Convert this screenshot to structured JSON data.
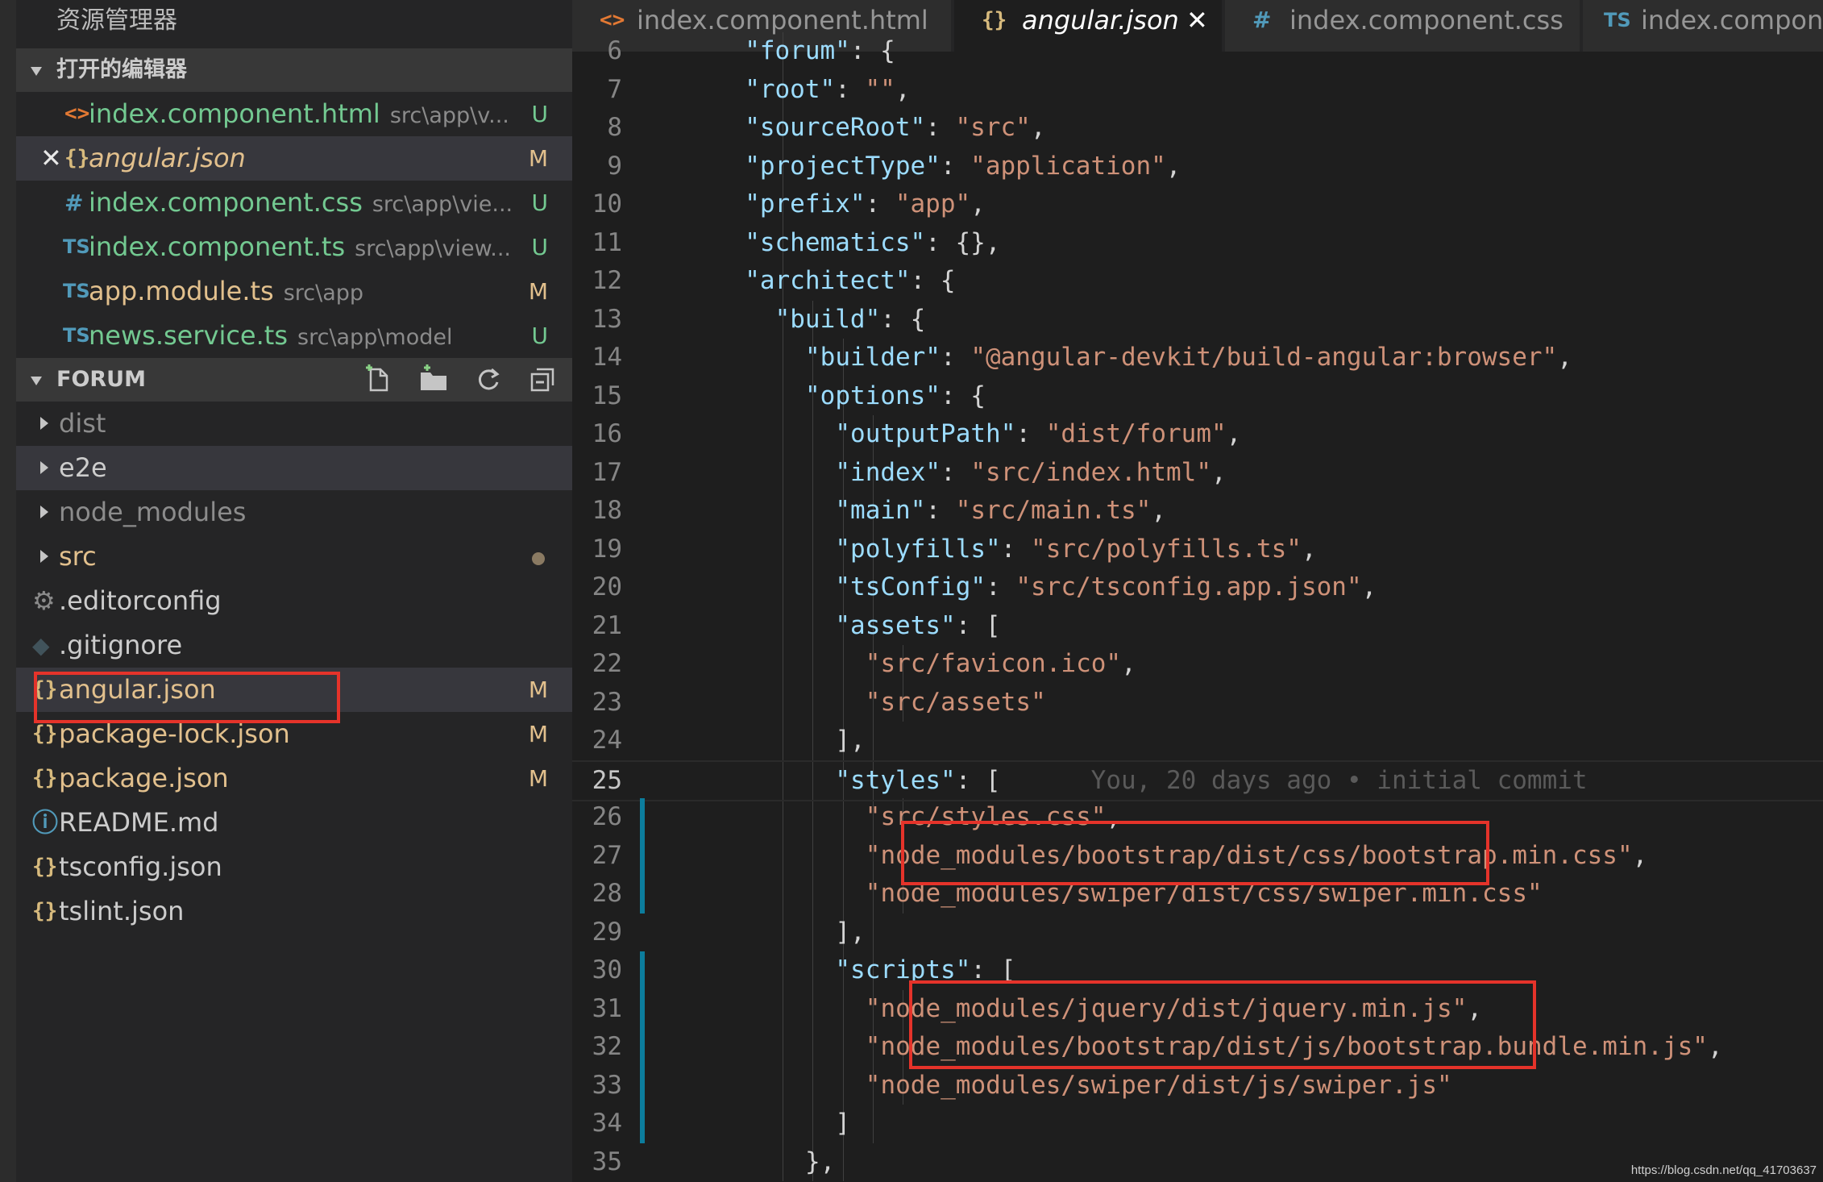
{
  "explorer": {
    "title": "资源管理器",
    "open_editors": {
      "header": "打开的编辑器",
      "items": [
        {
          "icon": "<>",
          "name": "index.component.html",
          "path": "src\\app\\v...",
          "badge": "U"
        },
        {
          "icon": "{}",
          "name": "angular.json",
          "path": "",
          "badge": "M"
        },
        {
          "icon": "#",
          "name": "index.component.css",
          "path": "src\\app\\vie...",
          "badge": "U"
        },
        {
          "icon": "TS",
          "name": "index.component.ts",
          "path": "src\\app\\view...",
          "badge": "U"
        },
        {
          "icon": "TS",
          "name": "app.module.ts",
          "path": "src\\app",
          "badge": "M"
        },
        {
          "icon": "TS",
          "name": "news.service.ts",
          "path": "src\\app\\model",
          "badge": "U"
        }
      ]
    },
    "project": {
      "header": "FORUM",
      "items": [
        {
          "name": "dist"
        },
        {
          "name": "e2e"
        },
        {
          "name": "node_modules"
        },
        {
          "name": "src"
        },
        {
          "name": ".editorconfig"
        },
        {
          "name": ".gitignore"
        },
        {
          "name": "angular.json",
          "badge": "M"
        },
        {
          "name": "package-lock.json",
          "badge": "M"
        },
        {
          "name": "package.json",
          "badge": "M"
        },
        {
          "name": "README.md"
        },
        {
          "name": "tsconfig.json"
        },
        {
          "name": "tslint.json"
        }
      ]
    }
  },
  "tabs": [
    {
      "icon": "<>",
      "label": "index.component.html"
    },
    {
      "icon": "{}",
      "label": "angular.json",
      "close": "✕"
    },
    {
      "icon": "#",
      "label": "index.component.css"
    },
    {
      "icon": "TS",
      "label": "index.compone"
    }
  ],
  "code": {
    "lines": [
      {
        "n": "6",
        "indent": 3,
        "key": "forum",
        "rest": ": {"
      },
      {
        "n": "7",
        "indent": 3,
        "key": "root",
        "str": "\"\"",
        "tail": ","
      },
      {
        "n": "8",
        "indent": 3,
        "key": "sourceRoot",
        "str": "\"src\"",
        "tail": ","
      },
      {
        "n": "9",
        "indent": 3,
        "key": "projectType",
        "str": "\"application\"",
        "tail": ","
      },
      {
        "n": "10",
        "indent": 3,
        "key": "prefix",
        "str": "\"app\"",
        "tail": ","
      },
      {
        "n": "11",
        "indent": 3,
        "key": "schematics",
        "rest": ": {},"
      },
      {
        "n": "12",
        "indent": 3,
        "key": "architect",
        "rest": ": {"
      },
      {
        "n": "13",
        "indent": 4,
        "key": "build",
        "rest": ": {"
      },
      {
        "n": "14",
        "indent": 5,
        "key": "builder",
        "str": "\"@angular-devkit/build-angular:browser\"",
        "tail": ","
      },
      {
        "n": "15",
        "indent": 5,
        "key": "options",
        "rest": ": {"
      },
      {
        "n": "16",
        "indent": 6,
        "key": "outputPath",
        "str": "\"dist/forum\"",
        "tail": ","
      },
      {
        "n": "17",
        "indent": 6,
        "key": "index",
        "str": "\"src/index.html\"",
        "tail": ","
      },
      {
        "n": "18",
        "indent": 6,
        "key": "main",
        "str": "\"src/main.ts\"",
        "tail": ","
      },
      {
        "n": "19",
        "indent": 6,
        "key": "polyfills",
        "str": "\"src/polyfills.ts\"",
        "tail": ","
      },
      {
        "n": "20",
        "indent": 6,
        "key": "tsConfig",
        "str": "\"src/tsconfig.app.json\"",
        "tail": ","
      },
      {
        "n": "21",
        "indent": 6,
        "key": "assets",
        "rest": ": ["
      },
      {
        "n": "22",
        "indent": 7,
        "str": "\"src/favicon.ico\"",
        "tail": ","
      },
      {
        "n": "23",
        "indent": 7,
        "str": "\"src/assets\"",
        "tail": ""
      },
      {
        "n": "24",
        "indent": 6,
        "rest": "],"
      },
      {
        "n": "25",
        "indent": 6,
        "key": "styles",
        "rest": ": [",
        "blame": "You, 20 days ago • initial commit"
      },
      {
        "n": "26",
        "indent": 7,
        "str": "\"src/styles.css\"",
        "tail": ","
      },
      {
        "n": "27",
        "indent": 7,
        "str": "\"node_modules/bootstrap/dist/css/bootstrap.min.css\"",
        "tail": ","
      },
      {
        "n": "28",
        "indent": 7,
        "str": "\"node_modules/swiper/dist/css/swiper.min.css\"",
        "tail": ""
      },
      {
        "n": "29",
        "indent": 6,
        "rest": "],"
      },
      {
        "n": "30",
        "indent": 6,
        "key": "scripts",
        "rest": ": ["
      },
      {
        "n": "31",
        "indent": 7,
        "str": "\"node_modules/jquery/dist/jquery.min.js\"",
        "tail": ","
      },
      {
        "n": "32",
        "indent": 7,
        "str": "\"node_modules/bootstrap/dist/js/bootstrap.bundle.min.js\"",
        "tail": ","
      },
      {
        "n": "33",
        "indent": 7,
        "str": "\"node_modules/swiper/dist/js/swiper.js\"",
        "tail": ""
      },
      {
        "n": "34",
        "indent": 6,
        "rest": "]"
      },
      {
        "n": "35",
        "indent": 5,
        "rest": "},"
      }
    ]
  },
  "watermark": "https://blog.csdn.net/qq_41703637",
  "colors": {
    "accent_red": "#e5332a",
    "modified": "#e2c08d",
    "untracked": "#73c991"
  }
}
